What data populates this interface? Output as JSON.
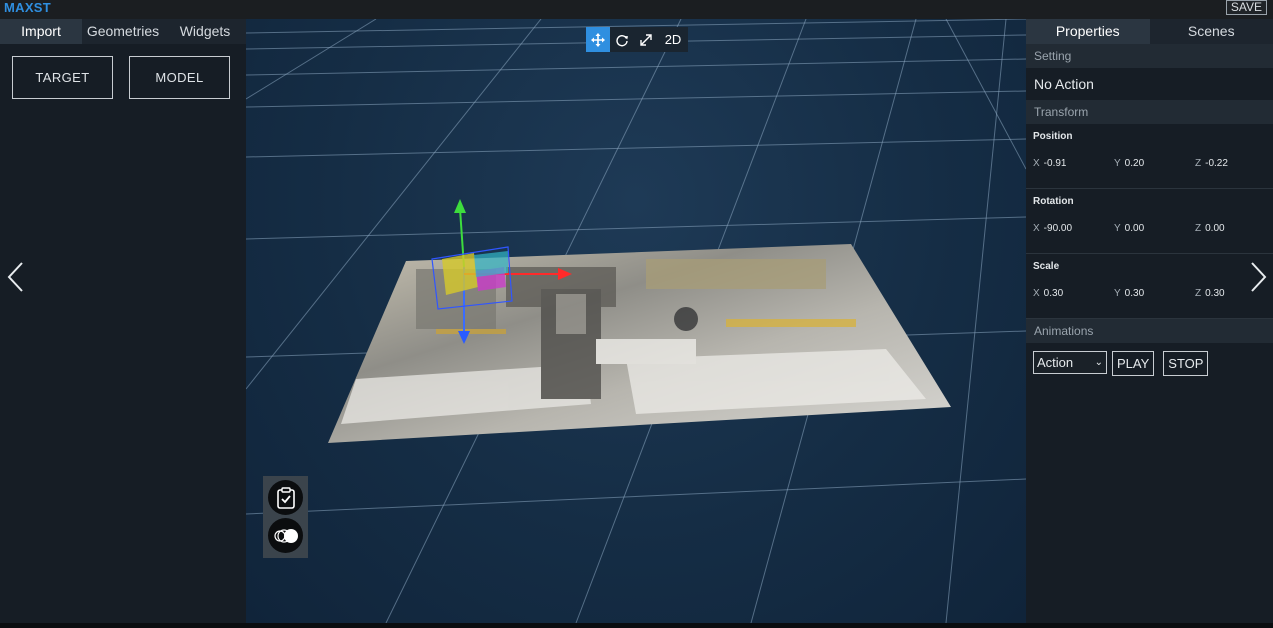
{
  "app": {
    "brand": "MAXST",
    "save_label": "SAVE"
  },
  "left_panel": {
    "tabs": [
      "Import",
      "Geometries",
      "Widgets"
    ],
    "active_tab": "Import",
    "import_buttons": [
      "TARGET",
      "MODEL"
    ]
  },
  "toolbar": {
    "mode_2d_label": "2D",
    "active_tool": "move"
  },
  "right_panel": {
    "tabs": [
      "Properties",
      "Scenes"
    ],
    "active_tab": "Properties",
    "setting_header": "Setting",
    "setting_value": "No Action",
    "transform_header": "Transform",
    "position": {
      "label": "Position",
      "x": "-0.91",
      "y": "0.20",
      "z": "-0.22"
    },
    "rotation": {
      "label": "Rotation",
      "x": "-90.00",
      "y": "0.00",
      "z": "0.00"
    },
    "scale": {
      "label": "Scale",
      "x": "0.30",
      "y": "0.30",
      "z": "0.30"
    },
    "axis_labels": {
      "x": "X",
      "y": "Y",
      "z": "Z"
    },
    "animations_header": "Animations",
    "action_select": "Action",
    "play_label": "PLAY",
    "stop_label": "STOP"
  },
  "colors": {
    "accent": "#2f8fe0",
    "panel": "#161d25",
    "viewport": "#152d45"
  }
}
